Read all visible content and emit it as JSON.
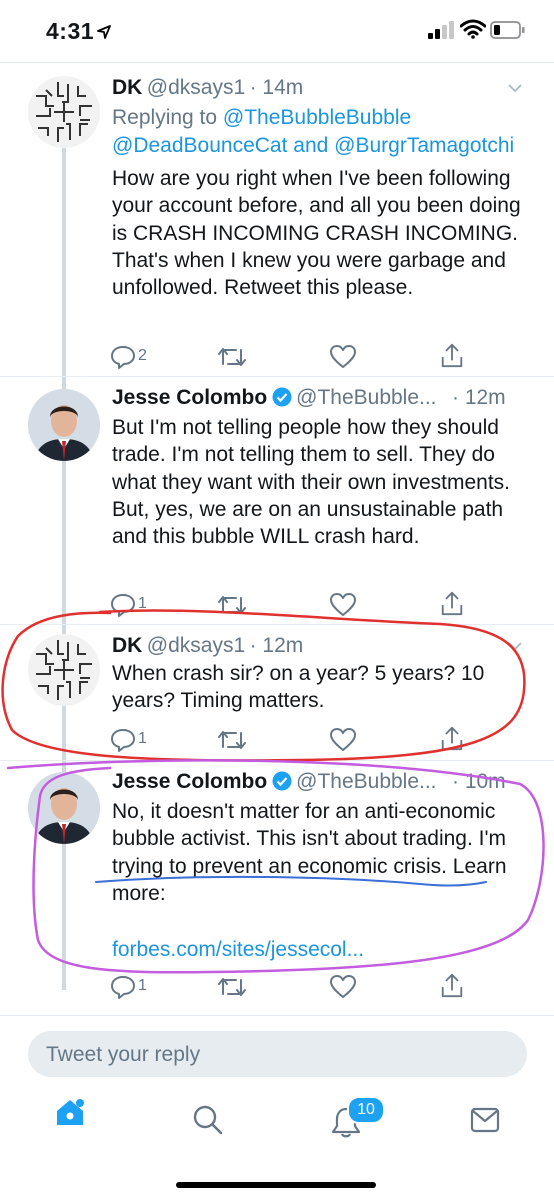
{
  "status_bar": {
    "time": "4:31"
  },
  "tweets": [
    {
      "name": "DK",
      "handle": "@dksays1",
      "time": "· 14m",
      "replying_prefix": "Replying to ",
      "replying_line1": "@TheBubbleBubble",
      "replying_line2_a": "@DeadBounceCat",
      "replying_line2_and": " and ",
      "replying_line2_b": "@BurgrTamagotchi",
      "text": "How are you right when I've been following your account before, and all you been doing is CRASH INCOMING CRASH INCOMING. That's when I knew you were garbage and unfollowed. Retweet this please.",
      "reply_count": "2"
    },
    {
      "name": "Jesse Colombo",
      "handle": "@TheBubble...",
      "time": "· 12m",
      "text": "But I'm not telling people how they should trade. I'm not telling them to sell. They do what they want with their own investments. But, yes, we are on an unsustainable path and this bubble WILL crash hard.",
      "reply_count": "1"
    },
    {
      "name": "DK",
      "handle": "@dksays1",
      "time": "· 12m",
      "text": "When crash sir? on a year? 5 years? 10 years? Timing matters.",
      "reply_count": "1"
    },
    {
      "name": "Jesse Colombo",
      "handle": "@TheBubble...",
      "time": "· 10m",
      "text": "No, it doesn't matter for an anti-economic bubble activist. This isn't about trading. I'm trying to prevent an economic crisis. Learn more:",
      "link": "forbes.com/sites/jessecol...",
      "reply_count": "1"
    }
  ],
  "compose": {
    "placeholder": "Tweet your reply"
  },
  "tab_bar": {
    "notifications_badge": "10"
  },
  "colors": {
    "accent": "#1da1f2",
    "link": "#1b95e0",
    "secondary_text": "#657786",
    "annotation_red": "#e0312f",
    "annotation_purple": "#c45ce0",
    "annotation_blue": "#3a6fd8"
  }
}
